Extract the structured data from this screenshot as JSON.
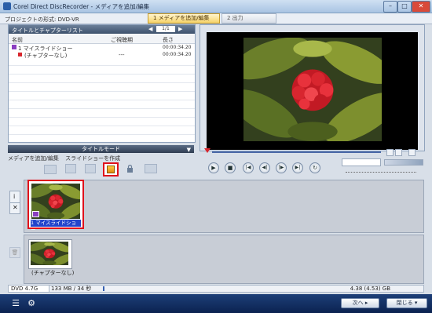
{
  "window": {
    "title": "Corel Direct DiscRecorder - メディアを追加/編集"
  },
  "steps": {
    "project_format": "プロジェクトの形式: DVD-VR",
    "step1": "1 メディアを追加/編集",
    "step2": "2   出力"
  },
  "media_list": {
    "header": "タイトルとチャプターリスト",
    "page": "1/1",
    "columns": {
      "name": "名前",
      "chapter": "ご視聴期",
      "length": "長さ"
    },
    "rows": [
      {
        "name": "1 マイスライドショー",
        "chapter": "",
        "length": "00:00:34.20"
      },
      {
        "name": "(チャプターなし)",
        "chapter": "---",
        "length": "00:00:34.20"
      }
    ]
  },
  "mode": {
    "title": "タイトルモード",
    "add_media": "メディアを追加/編集",
    "slideshow": "スライドショーを作成"
  },
  "slides": [
    {
      "caption": "1 マイスライドショー"
    },
    {
      "caption": "(チャプターなし)"
    }
  ],
  "status": {
    "disc": "DVD 4.7G",
    "used": "133 MB / 34 秒",
    "free": "4.38 (4.53) GB"
  },
  "footer": {
    "next": "次へ",
    "close": "閉じる"
  },
  "colors": {
    "highlight": "#e0101b",
    "footer": "#1d3f78",
    "step_active": "#f7d36a"
  },
  "icons": [
    "list-icon",
    "settings-icon",
    "play-icon",
    "stop-icon",
    "prev-icon",
    "rewind-icon",
    "forward-icon",
    "next-icon",
    "repeat-icon",
    "lock-icon"
  ]
}
